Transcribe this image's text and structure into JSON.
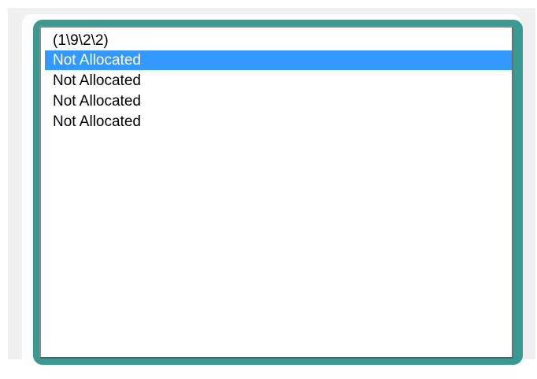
{
  "listbox": {
    "items": [
      {
        "label": "(1\\9\\2\\2)",
        "selected": false
      },
      {
        "label": "Not Allocated",
        "selected": true
      },
      {
        "label": "Not Allocated",
        "selected": false
      },
      {
        "label": "Not Allocated",
        "selected": false
      },
      {
        "label": "Not Allocated",
        "selected": false
      }
    ]
  },
  "colors": {
    "frame": "#3a9a92",
    "selection": "#3399ff",
    "panel_background": "#f0f0f0"
  }
}
